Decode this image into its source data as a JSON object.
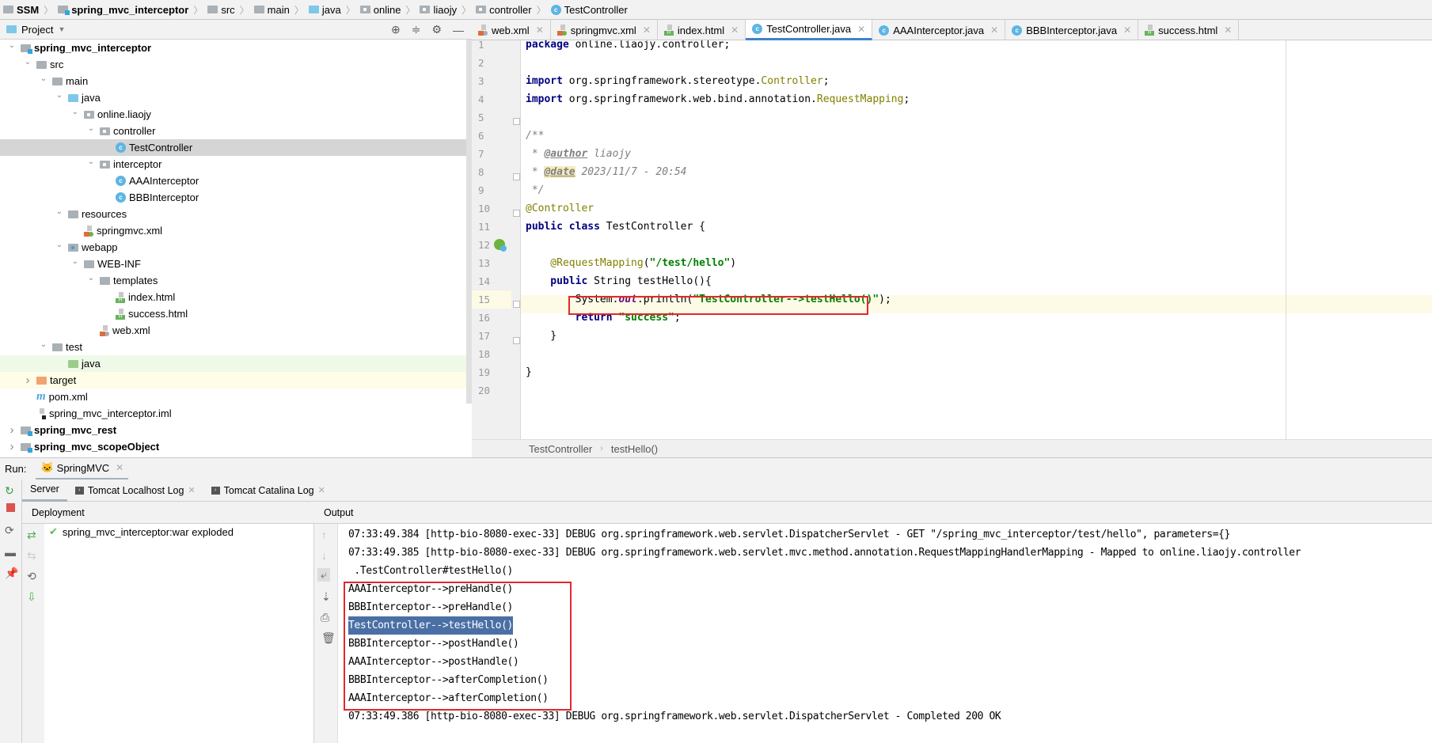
{
  "breadcrumb": {
    "items": [
      {
        "label": "SSM",
        "icon": "project-folder-icon",
        "bold": true
      },
      {
        "label": "spring_mvc_interceptor",
        "icon": "module-folder-icon",
        "bold": true
      },
      {
        "label": "src",
        "icon": "folder-icon"
      },
      {
        "label": "main",
        "icon": "folder-icon"
      },
      {
        "label": "java",
        "icon": "source-folder-icon"
      },
      {
        "label": "online",
        "icon": "package-icon"
      },
      {
        "label": "liaojy",
        "icon": "package-icon"
      },
      {
        "label": "controller",
        "icon": "package-icon"
      },
      {
        "label": "TestController",
        "icon": "class-icon"
      }
    ]
  },
  "project_panel": {
    "title": "Project",
    "tools": [
      "locate-icon",
      "collapse-all-icon",
      "gear-icon",
      "minimize-icon"
    ],
    "tree": [
      {
        "label": "spring_mvc_interceptor",
        "depth": 1,
        "expanded": true,
        "icon": "module",
        "bold": true
      },
      {
        "label": "src",
        "depth": 2,
        "expanded": true,
        "icon": "folder"
      },
      {
        "label": "main",
        "depth": 3,
        "expanded": true,
        "icon": "folder"
      },
      {
        "label": "java",
        "depth": 4,
        "expanded": true,
        "icon": "source"
      },
      {
        "label": "online.liaojy",
        "depth": 5,
        "expanded": true,
        "icon": "package"
      },
      {
        "label": "controller",
        "depth": 6,
        "expanded": true,
        "icon": "package"
      },
      {
        "label": "TestController",
        "depth": 7,
        "icon": "class",
        "selected": true
      },
      {
        "label": "interceptor",
        "depth": 6,
        "expanded": true,
        "icon": "package"
      },
      {
        "label": "AAAInterceptor",
        "depth": 7,
        "icon": "class"
      },
      {
        "label": "BBBInterceptor",
        "depth": 7,
        "icon": "class"
      },
      {
        "label": "resources",
        "depth": 4,
        "expanded": true,
        "icon": "resources"
      },
      {
        "label": "springmvc.xml",
        "depth": 5,
        "icon": "spring-xml"
      },
      {
        "label": "webapp",
        "depth": 4,
        "expanded": true,
        "icon": "web"
      },
      {
        "label": "WEB-INF",
        "depth": 5,
        "expanded": true,
        "icon": "folder"
      },
      {
        "label": "templates",
        "depth": 6,
        "expanded": true,
        "icon": "folder"
      },
      {
        "label": "index.html",
        "depth": 7,
        "icon": "html"
      },
      {
        "label": "success.html",
        "depth": 7,
        "icon": "html"
      },
      {
        "label": "web.xml",
        "depth": 6,
        "icon": "web-xml"
      },
      {
        "label": "test",
        "depth": 3,
        "expanded": true,
        "icon": "folder"
      },
      {
        "label": "java",
        "depth": 4,
        "icon": "test-source",
        "row": "green"
      },
      {
        "label": "target",
        "depth": 2,
        "expanded": false,
        "icon": "excluded",
        "row": "yellow"
      },
      {
        "label": "pom.xml",
        "depth": 2,
        "icon": "maven"
      },
      {
        "label": "spring_mvc_interceptor.iml",
        "depth": 2,
        "icon": "iml"
      },
      {
        "label": "spring_mvc_rest",
        "depth": 1,
        "expanded": false,
        "icon": "module",
        "bold": true
      },
      {
        "label": "spring_mvc_scopeObject",
        "depth": 1,
        "expanded": false,
        "icon": "module",
        "bold": true
      }
    ]
  },
  "editor": {
    "tabs": [
      {
        "label": "web.xml",
        "icon": "web-xml"
      },
      {
        "label": "springmvc.xml",
        "icon": "spring-xml"
      },
      {
        "label": "index.html",
        "icon": "html"
      },
      {
        "label": "TestController.java",
        "icon": "class",
        "active": true
      },
      {
        "label": "AAAInterceptor.java",
        "icon": "class"
      },
      {
        "label": "BBBInterceptor.java",
        "icon": "class"
      },
      {
        "label": "success.html",
        "icon": "html"
      }
    ],
    "line_numbers": [
      "1",
      "2",
      "3",
      "4",
      "5",
      "6",
      "7",
      "8",
      "9",
      "10",
      "11",
      "12",
      "13",
      "14",
      "15",
      "16",
      "17",
      "18",
      "19",
      "20"
    ],
    "code": {
      "l1_kw": "package",
      "l1_rest": " online.liaojy.controller;",
      "l3_kw": "import",
      "l3_rest": " org.springframework.stereotype.",
      "l3_ann": "Controller",
      "l3_end": ";",
      "l4_kw": "import",
      "l4_rest": " org.springframework.web.bind.annotation.",
      "l4_ann": "RequestMapping",
      "l4_end": ";",
      "l6": "/**",
      "l7_pre": " * ",
      "l7_tag": "@author",
      "l7_rest": " liaojy",
      "l8_pre": " * ",
      "l8_tag": "@date",
      "l8_rest": " 2023/11/7 - 20:54",
      "l9": " */",
      "l10": "@Controller",
      "l11_kw": "public class",
      "l11_rest": " TestController {",
      "l13_ann": "    @RequestMapping",
      "l13_p1": "(",
      "l13_str": "\"/test/hello\"",
      "l13_p2": ")",
      "l14_kw": "    public",
      "l14_rest": " String testHello(){",
      "l15_pre": "        System.",
      "l15_fld": "out",
      "l15_mid": ".println(",
      "l15_str": "\"TestController-->testHello()\"",
      "l15_end": ");",
      "l16_kw": "        return",
      "l16_sp": " ",
      "l16_str": "\"success\"",
      "l16_end": ";",
      "l17": "    }",
      "l19": "}"
    },
    "current_line": 15,
    "breadcrumb": [
      "TestController",
      "testHello()"
    ]
  },
  "run_panel": {
    "label": "Run:",
    "config_tab": "SpringMVC",
    "sub_tabs": [
      {
        "label": "Server",
        "active": true
      },
      {
        "label": "Tomcat Localhost Log"
      },
      {
        "label": "Tomcat Catalina Log"
      }
    ],
    "deployment_header": "Deployment",
    "deployment_items": [
      {
        "label": "spring_mvc_interceptor:war exploded",
        "status": "ok"
      }
    ],
    "output_header": "Output",
    "output_lines": [
      "07:33:49.384 [http-bio-8080-exec-33] DEBUG org.springframework.web.servlet.DispatcherServlet - GET \"/spring_mvc_interceptor/test/hello\", parameters={}",
      "07:33:49.385 [http-bio-8080-exec-33] DEBUG org.springframework.web.servlet.mvc.method.annotation.RequestMappingHandlerMapping - Mapped to online.liaojy.controller",
      " .TestController#testHello()",
      "AAAInterceptor-->preHandle()",
      "BBBInterceptor-->preHandle()",
      "TestController-->testHello()",
      "BBBInterceptor-->postHandle()",
      "AAAInterceptor-->postHandle()",
      "BBBInterceptor-->afterCompletion()",
      "AAAInterceptor-->afterCompletion()",
      "07:33:49.386 [http-bio-8080-exec-33] DEBUG org.springframework.web.servlet.DispatcherServlet - Completed 200 OK"
    ],
    "selected_output_line": 5
  },
  "colors": {
    "highlight_box": "#e0282e",
    "active_tab": "#4083c9",
    "selection": "#4a6fa5"
  }
}
